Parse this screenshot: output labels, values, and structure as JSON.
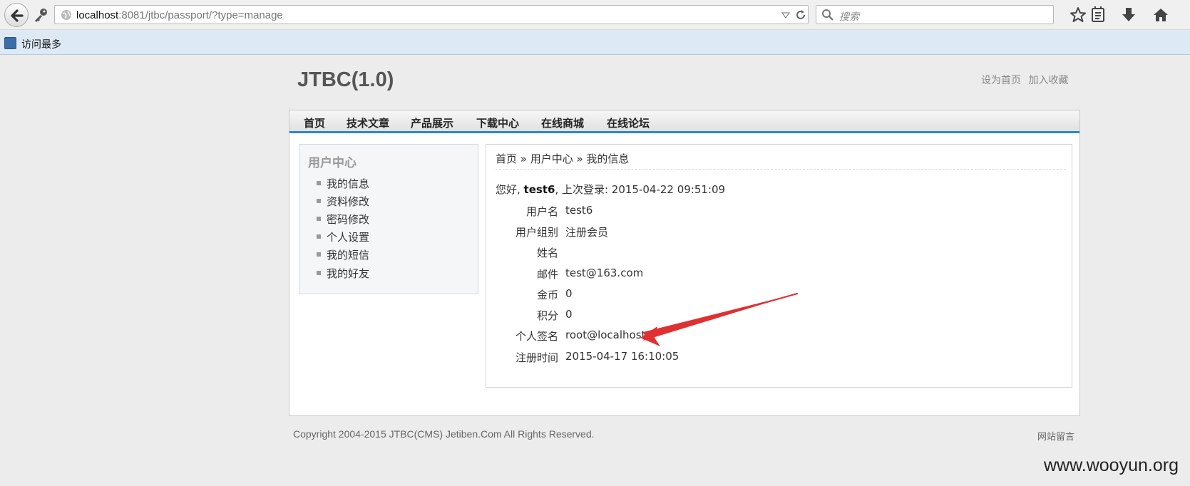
{
  "browser": {
    "url_host": "localhost",
    "url_rest": ":8081/jtbc/passport/?type=manage",
    "search_placeholder": "搜索",
    "bookmark_label": "访问最多"
  },
  "site": {
    "title": "JTBC(1.0)",
    "top_links": [
      "设为首页",
      "加入收藏"
    ]
  },
  "nav": {
    "items": [
      "首页",
      "技术文章",
      "产品展示",
      "下载中心",
      "在线商城",
      "在线论坛"
    ]
  },
  "sidebar": {
    "title": "用户中心",
    "items": [
      "我的信息",
      "资料修改",
      "密码修改",
      "个人设置",
      "我的短信",
      "我的好友"
    ]
  },
  "content": {
    "breadcrumb": "首页 » 用户中心 » 我的信息",
    "greeting_prefix": "您好, ",
    "username": "test6",
    "greeting_suffix": ", 上次登录: 2015-04-22 09:51:09",
    "fields": [
      {
        "label": "用户名",
        "value": "test6"
      },
      {
        "label": "用户组别",
        "value": "注册会员"
      },
      {
        "label": "姓名",
        "value": ""
      },
      {
        "label": "邮件",
        "value": "test@163.com"
      },
      {
        "label": "金币",
        "value": "0"
      },
      {
        "label": "积分",
        "value": "0"
      },
      {
        "label": "个人签名",
        "value": "root@localhost"
      },
      {
        "label": "注册时间",
        "value": "2015-04-17 16:10:05"
      }
    ]
  },
  "footer": {
    "copyright": "Copyright 2004-2015 JTBC(CMS) Jetiben.Com All Rights Reserved.",
    "link": "网站留言"
  },
  "watermark": "www.wooyun.org",
  "colors": {
    "nav_accent": "#2a88c6",
    "annotation_arrow": "#e03030"
  }
}
